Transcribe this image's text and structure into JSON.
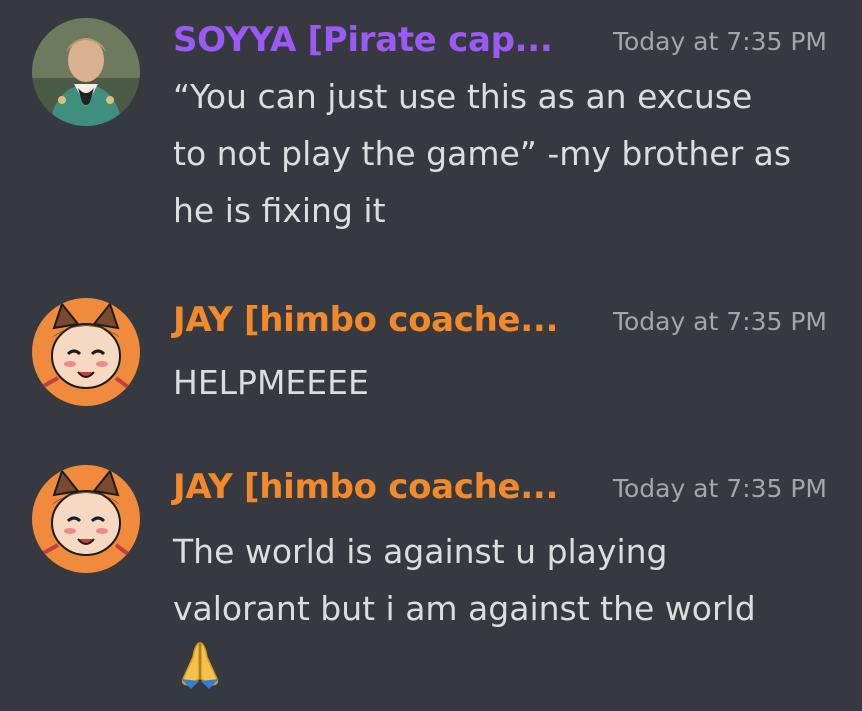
{
  "colors": {
    "background": "#36393f",
    "soyya_name": "#9b59f5",
    "jay_name": "#f2892b",
    "timestamp": "#a3a6aa",
    "text": "#dcddde"
  },
  "messages": [
    {
      "author": "SOYYA [Pirate cap...",
      "timestamp": "Today at 7:35 PM",
      "avatar": "pirate-captain-avatar",
      "lines": [
        "“You can just use this as an excuse",
        "to not play the game” -my brother as",
        "he is fixing it"
      ]
    },
    {
      "author": "JAY [himbo coache...",
      "timestamp": "Today at 7:35 PM",
      "avatar": "cartoon-cat-avatar",
      "lines": [
        "HELPMEEEE"
      ]
    },
    {
      "author": "JAY [himbo coache...",
      "timestamp": "Today at 7:35 PM",
      "avatar": "cartoon-cat-avatar",
      "lines": [
        "The world is against u playing",
        "valorant but i am against the world"
      ],
      "emoji": "folded-hands-emoji"
    }
  ]
}
